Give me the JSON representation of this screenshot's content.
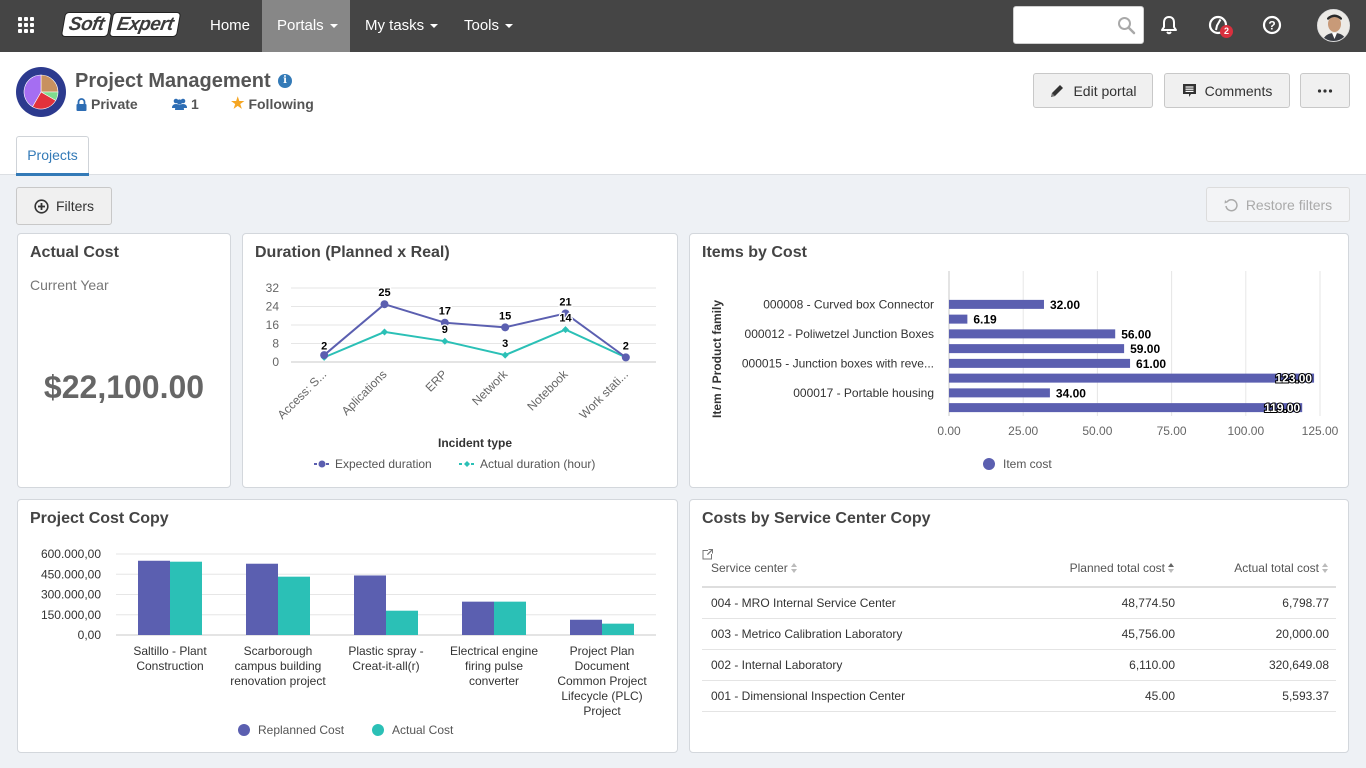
{
  "topbar": {
    "logo_part1": "Soft",
    "logo_part2": "Expert",
    "nav": [
      {
        "label": "Home",
        "has_dropdown": false,
        "active": false
      },
      {
        "label": "Portals",
        "has_dropdown": true,
        "active": true
      },
      {
        "label": "My tasks",
        "has_dropdown": true,
        "active": false
      },
      {
        "label": "Tools",
        "has_dropdown": true,
        "active": false
      }
    ],
    "search": {
      "value": "",
      "placeholder": ""
    },
    "compass_badge": "2"
  },
  "portal": {
    "title": "Project Management",
    "privacy": "Private",
    "members": "1",
    "follow_status": "Following",
    "actions": {
      "edit": "Edit portal",
      "comments": "Comments"
    }
  },
  "tabs": [
    {
      "label": "Projects",
      "active": true
    }
  ],
  "toolbar": {
    "filters": "Filters",
    "restore_filters": "Restore filters",
    "restore_disabled": true
  },
  "widgets": {
    "actual_cost": {
      "title": "Actual Cost",
      "subtitle": "Current Year",
      "value": "$22,100.00"
    },
    "costs_by_service_center": {
      "title": "Costs by Service Center Copy",
      "columns": [
        "Service center",
        "Planned total cost",
        "Actual total cost"
      ],
      "rows": [
        {
          "service_center": "004 - MRO Internal Service Center",
          "planned": "48,774.50",
          "actual": "6,798.77"
        },
        {
          "service_center": "003 - Metrico Calibration Laboratory",
          "planned": "45,756.00",
          "actual": "20,000.00"
        },
        {
          "service_center": "002 - Internal Laboratory",
          "planned": "6,110.00",
          "actual": "320,649.08"
        },
        {
          "service_center": "001 - Dimensional Inspection Center",
          "planned": "45.00",
          "actual": "5,593.37"
        }
      ]
    }
  },
  "colors": {
    "accent": "#337ab7",
    "topbar": "#454545",
    "badge": "#d9303e",
    "star": "#f5a623",
    "series_purple": "#5b5fb0",
    "series_teal": "#2bc0b6"
  },
  "chart_data": [
    {
      "type": "line",
      "title": "Duration (Planned x Real)",
      "xlabel": "Incident type",
      "ylabel": "",
      "categories": [
        "Access: S...",
        "Aplications",
        "ERP",
        "Network",
        "Notebook",
        "Work stati..."
      ],
      "yticks": [
        0,
        8,
        16,
        24,
        32
      ],
      "ylim": [
        0,
        32
      ],
      "grid": true,
      "legend": "bottom",
      "series": [
        {
          "name": "Expected duration",
          "color": "#5b5fb0",
          "values": [
            3,
            25,
            17,
            15,
            21,
            2
          ],
          "labeled": [
            false,
            true,
            true,
            true,
            true,
            true
          ]
        },
        {
          "name": "Actual duration (hour)",
          "color": "#2bc0b6",
          "values": [
            2,
            13,
            9,
            3,
            14,
            2
          ],
          "labeled": [
            true,
            false,
            true,
            true,
            true,
            false
          ]
        }
      ]
    },
    {
      "type": "bar",
      "orientation": "horizontal",
      "title": "Items by Cost",
      "xlabel": "",
      "ylabel": "Item / Product family",
      "categories": [
        "000008 - Curved box Connector",
        "",
        "000012 - Poliwetzel Junction Boxes",
        "",
        "000015 - Junction boxes with reve...",
        "",
        "000017 - Portable housing",
        ""
      ],
      "values": [
        32.0,
        6.19,
        56.0,
        59.0,
        61.0,
        123.0,
        34.0,
        119.0
      ],
      "value_labels": [
        "32.00",
        "6.19",
        "56.00",
        "59.00",
        "61.00",
        "123.00",
        "34.00",
        "119.00"
      ],
      "xticks": [
        0,
        25,
        50,
        75,
        100,
        125
      ],
      "xtick_labels": [
        "0.00",
        "25.00",
        "50.00",
        "75.00",
        "100.00",
        "125.00"
      ],
      "xlim": [
        0,
        125
      ],
      "grid": true,
      "legend": "bottom",
      "series_name": "Item cost",
      "color": "#5b5fb0"
    },
    {
      "type": "bar",
      "orientation": "vertical",
      "title": "Project Cost Copy",
      "xlabel": "",
      "ylabel": "",
      "categories": [
        [
          "Saltillo - Plant",
          "Construction"
        ],
        [
          "Scarborough",
          "campus building",
          "renovation project"
        ],
        [
          "Plastic spray -",
          "Creat-it-all(r)"
        ],
        [
          "Electrical engine",
          "firing pulse",
          "converter"
        ],
        [
          "Project Plan",
          "Document",
          "Common Project",
          "Lifecycle (PLC)",
          "Project"
        ]
      ],
      "yticks": [
        0,
        150000,
        300000,
        450000,
        600000
      ],
      "ytick_labels": [
        "0,00",
        "150.000,00",
        "300.000,00",
        "450.000,00",
        "600.000,00"
      ],
      "ylim": [
        0,
        600000
      ],
      "grid": true,
      "legend": "bottom",
      "series": [
        {
          "name": "Replanned Cost",
          "color": "#5b5fb0",
          "values": [
            550000,
            528000,
            441000,
            247000,
            113000
          ]
        },
        {
          "name": "Actual Cost",
          "color": "#2bc0b6",
          "values": [
            543000,
            432000,
            180000,
            247000,
            84000
          ]
        }
      ]
    }
  ]
}
